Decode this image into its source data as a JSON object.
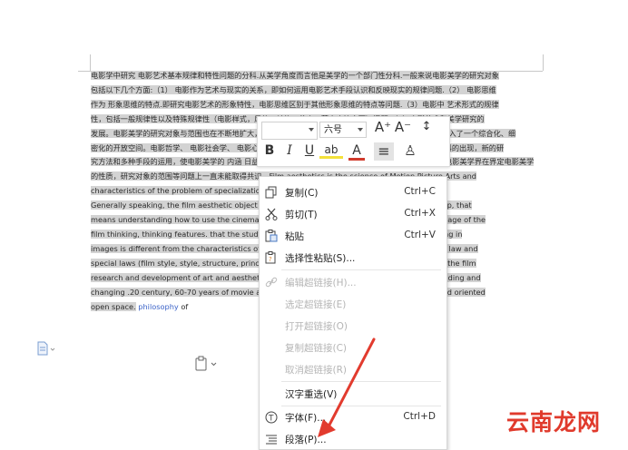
{
  "document": {
    "lines": [
      {
        "sel": "电影学中研究  电影艺术基本规律和特性问题的分科.从美学角度而言他是美学的一个部门性分科.一般来说电影美学的研究对象"
      },
      {
        "sel": "包括以下几个方面:（1） 电影作为艺术与现实的关系，即如何运用电影艺术手段认识和反映现实的规律问题.（2） 电影思维"
      },
      {
        "sel": "作为 形象思维的特点.即研究电影艺术的形象特性，电影思维区别于其他形象思维的特点等问题.（3）电影中 艺术形式的规律"
      },
      {
        "sel": "性，包括一般规律性以及特殊规律性（电影样式，风格，结构，节奏，蒙太奇等方面）问题.（4）电影艺术和美学研究的"
      },
      {
        "sel": "发展。电影美学的研究对象与范围也在不断地扩大，20世纪60-70年代电影美学的研究日益向纵深发展，已走入了一个综合化、细"
      },
      {
        "sel": "密化的开放空间。电影哲学、 电影社会学、 电影心理学、 电影社会心理学、 电影符号学、 电影叙事学等学科的出现，新的研"
      },
      {
        "sel": "究方法和多种手段的运用，使电影美学的 内涵 日益丰富与发展，电影美学的研究方法与视野也日趋多样化，电影美学界在界定电影美学"
      },
      {
        "sel": "的性质，研究对象的范围等问题上一直未能取得共识。Film aesthetics is the science of Motion Picture Arts and"
      },
      {
        "sel": "characteristics of the problem of specialization. Aesthetics is a branch of Division of aesthetics."
      },
      {
        "sel": "Generally speaking, the film aesthetic object of study are: (1) the film art and reality relationship, that"
      },
      {
        "sel": "means understanding how to use the cinematic means to reflect the law of reality. (2) as the image of the"
      },
      {
        "sel": "film thinking, thinking features. that the study of the image of movies and other movies, thinking in"
      },
      {
        "sel": "images is different from the characteristics of other issues of artistic form including the general law and"
      },
      {
        "sel": "special laws (film style, style, structure, principles of film, rhythm, Montage etc.) problem. With the film"
      },
      {
        "sel": "research and development of art and aesthetics, the range of study has been continually expanding and"
      },
      {
        "sel": "changing .20 century, 60-70 years of movie aesthetics increasingly comprehensive, detailed and oriented"
      },
      {
        "sel": "open space.",
        "link": "philosophy",
        "tail": "of"
      }
    ]
  },
  "toolbar": {
    "font_value": "",
    "size_value": "六号",
    "grow_font": "A⁺",
    "shrink_font": "A⁻",
    "line_spacing": "↕",
    "bold": "B",
    "italic": "I",
    "underline": "U",
    "highlight": "ab",
    "font_color": "A",
    "align": "≡",
    "format_painter": "♙"
  },
  "context_menu": {
    "items": [
      {
        "label": "复制(C)",
        "shortcut": "Ctrl+C",
        "icon": "copy-icon",
        "disabled": false
      },
      {
        "label": "剪切(T)",
        "shortcut": "Ctrl+X",
        "icon": "cut-icon",
        "disabled": false
      },
      {
        "label": "粘贴",
        "shortcut": "Ctrl+V",
        "icon": "paste-icon",
        "disabled": false
      },
      {
        "label": "选择性粘贴(S)...",
        "shortcut": "",
        "icon": "paste-special-icon",
        "disabled": false
      },
      {
        "label": "编辑超链接(H)...",
        "shortcut": "",
        "icon": "link-icon",
        "disabled": true
      },
      {
        "label": "选定超链接(E)",
        "shortcut": "",
        "icon": "",
        "disabled": true
      },
      {
        "label": "打开超链接(O)",
        "shortcut": "",
        "icon": "",
        "disabled": true
      },
      {
        "label": "复制超链接(C)",
        "shortcut": "",
        "icon": "",
        "disabled": true
      },
      {
        "label": "取消超链接(R)",
        "shortcut": "",
        "icon": "",
        "disabled": true
      },
      {
        "label": "汉字重选(V)",
        "shortcut": "",
        "icon": "",
        "disabled": false
      },
      {
        "label": "字体(F)...",
        "shortcut": "Ctrl+D",
        "icon": "font-icon",
        "disabled": false
      },
      {
        "label": "段落(P)...",
        "shortcut": "",
        "icon": "paragraph-icon",
        "disabled": false
      }
    ]
  },
  "watermark": "云南龙网",
  "colors": {
    "link": "#3b63c8",
    "selection": "#d3d3d3",
    "arrow": "#e23b2e",
    "watermark": "#e03a2c"
  }
}
